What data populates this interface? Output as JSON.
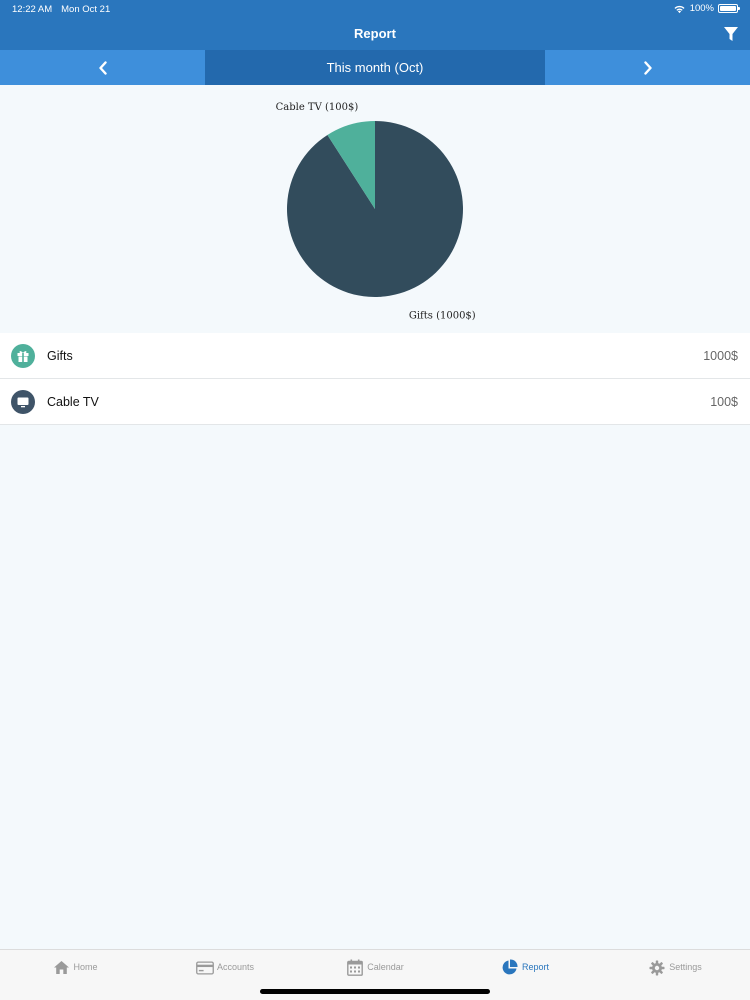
{
  "status_bar": {
    "time": "12:22 AM",
    "date": "Mon Oct 21",
    "battery": "100%"
  },
  "header": {
    "title": "Report",
    "filter_icon": "filter-icon"
  },
  "period": {
    "label": "This month (Oct)",
    "prev_icon": "chevron-left-icon",
    "next_icon": "chevron-right-icon"
  },
  "chart_data": {
    "type": "pie",
    "title": "",
    "slices": [
      {
        "label": "Gifts (1000$)",
        "category": "Gifts",
        "value": 1000,
        "color": "#324c5c"
      },
      {
        "label": "Cable TV (100$)",
        "category": "Cable TV",
        "value": 100,
        "color": "#4fb09b"
      }
    ]
  },
  "list": [
    {
      "name": "Gifts",
      "amount": "1000$",
      "icon": "gift-icon",
      "color": "#4fb09b"
    },
    {
      "name": "Cable TV",
      "amount": "100$",
      "icon": "tv-icon",
      "color": "#3f5468"
    }
  ],
  "tabs": [
    {
      "label": "Home",
      "icon": "home-icon",
      "active": false
    },
    {
      "label": "Accounts",
      "icon": "card-icon",
      "active": false
    },
    {
      "label": "Calendar",
      "icon": "calendar-icon",
      "active": false
    },
    {
      "label": "Report",
      "icon": "pie-chart-icon",
      "active": true
    },
    {
      "label": "Settings",
      "icon": "gear-icon",
      "active": false
    }
  ],
  "colors": {
    "header": "#2a76bd",
    "period_bar": "#3e8fdb",
    "period_current": "#2369ad",
    "accent": "#2a76bd"
  }
}
